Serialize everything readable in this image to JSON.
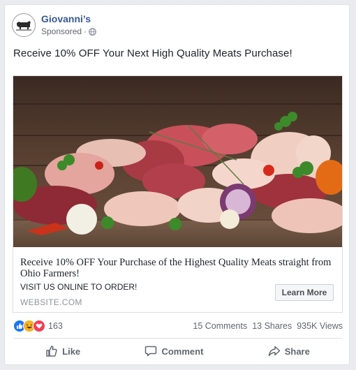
{
  "post": {
    "page_name": "Giovanni’s",
    "sponsored_label": "Sponsored",
    "dot": "·",
    "text": "Receive 10% OFF Your Next High Quality Meats Purchase!"
  },
  "ad": {
    "headline": "Receive 10% OFF Your Purchase of the Highest Quality Meats straight from Ohio Farmers!",
    "description": "VISIT US ONLINE TO ORDER!",
    "domain": "WEBSITE.COM",
    "cta_label": "Learn More"
  },
  "stats": {
    "reactions_count": "163",
    "comments": "15 Comments",
    "shares": "13 Shares",
    "views": "935K Views"
  },
  "actions": {
    "like": "Like",
    "comment": "Comment",
    "share": "Share"
  },
  "icons": {
    "avatar": "bull-logo-icon",
    "audience": "globe-icon",
    "reaction_1": "like-reaction-icon",
    "reaction_2": "haha-reaction-icon",
    "reaction_3": "love-reaction-icon",
    "like": "thumbs-up-icon",
    "comment": "comment-icon",
    "share": "share-arrow-icon"
  },
  "colors": {
    "link_blue": "#365899",
    "like_blue": "#1877f2",
    "love_red": "#f33e58",
    "haha_yellow": "#f7b125"
  }
}
